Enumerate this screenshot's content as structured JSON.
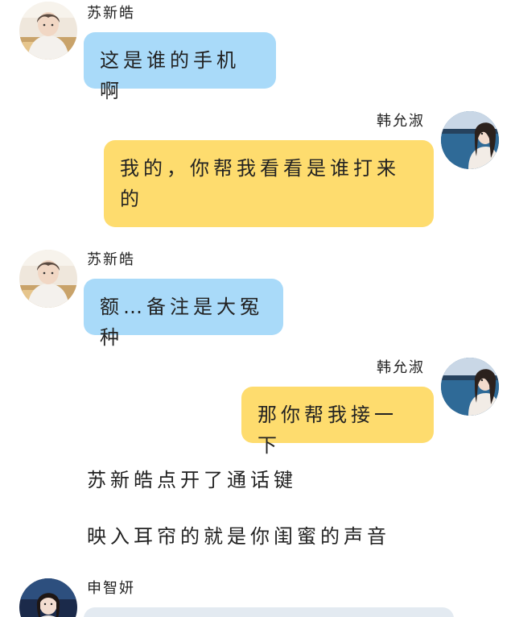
{
  "messages": [
    {
      "sender": "苏新皓",
      "text": "这是谁的手机啊",
      "side": "left",
      "bubble_color": "#a9daf9"
    },
    {
      "sender": "韩允淑",
      "text": "我的，你帮我看看是谁打来的",
      "side": "right",
      "bubble_color": "#fedc6e"
    },
    {
      "sender": "苏新皓",
      "text": "额…备注是大冤种",
      "side": "left",
      "bubble_color": "#a9daf9"
    },
    {
      "sender": "韩允淑",
      "text": "那你帮我接一下",
      "side": "right",
      "bubble_color": "#fedc6e"
    }
  ],
  "narration": [
    "苏新皓点开了通话键",
    "映入耳帘的就是你闺蜜的声音"
  ],
  "last_message": {
    "sender": "申智妍",
    "text": "",
    "bubble_color": "#e3eaf1"
  },
  "avatar_icons": {
    "su_xinhao": "boy-portrait-avatar",
    "han_yunshu": "girl-seaside-avatar",
    "shen_zhiyan": "girl-night-avatar"
  }
}
